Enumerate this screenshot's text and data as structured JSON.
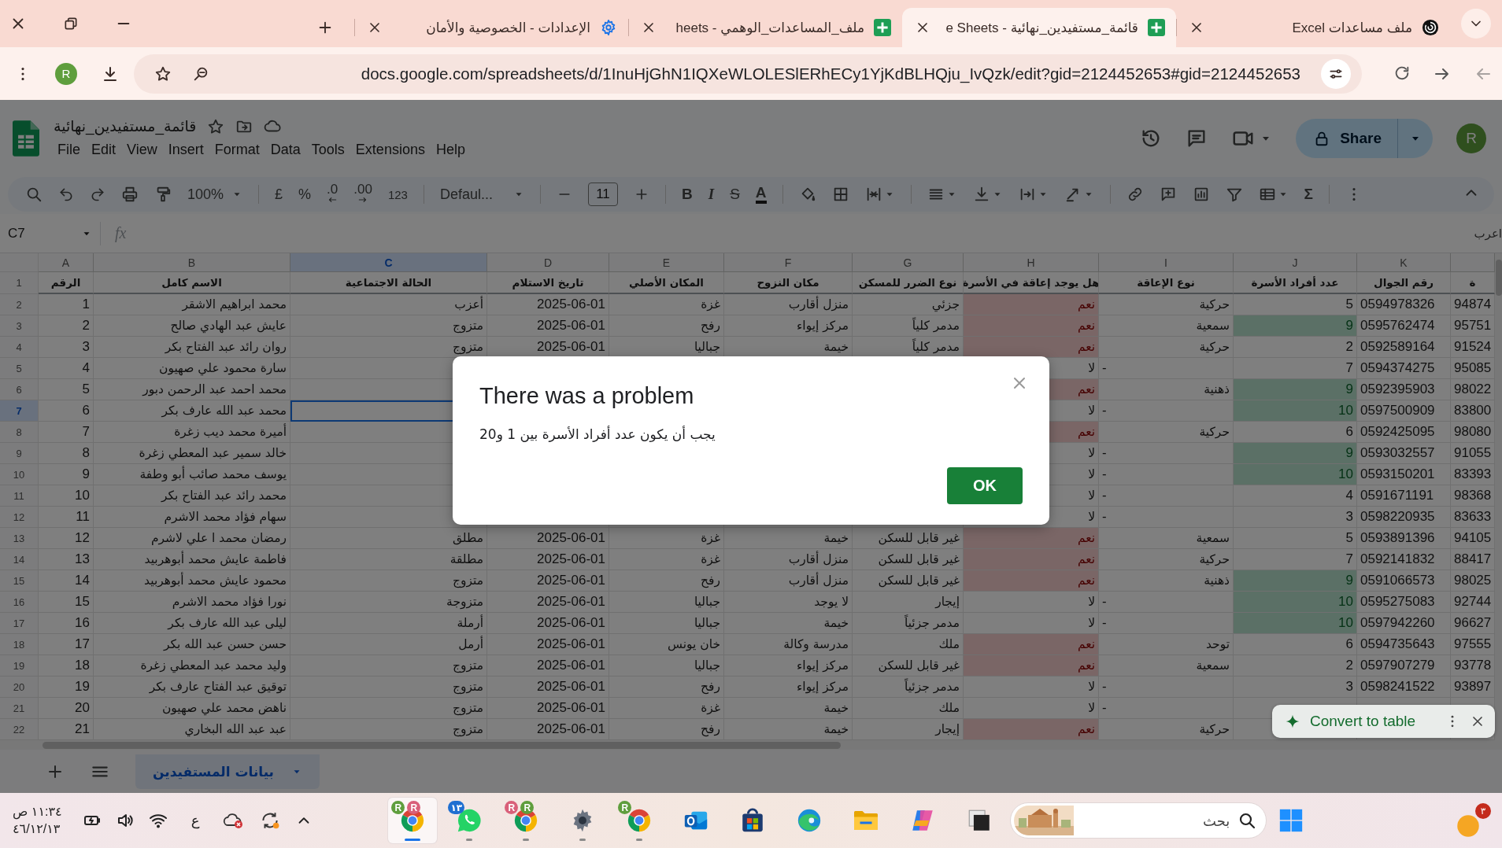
{
  "browser_tabs": [
    {
      "title": "ملف مساعدات Excel",
      "kind": "swirl",
      "selected": false
    },
    {
      "title": "قائمة_مستفيدين_نهائية - e Sheets",
      "kind": "sheets",
      "selected": true
    },
    {
      "title": "ملف_المساعدات_الوهمي - heets",
      "kind": "sheets",
      "selected": false
    },
    {
      "title": "الإعدادات - الخصوصية والأمان",
      "kind": "settings",
      "selected": false
    }
  ],
  "address_bar": {
    "profile_initial": "R",
    "url": "docs.google.com/spreadsheets/d/1InuHjGhN1IQXeWLOLESlERhECy1YjKdBLHQju_IvQzk/edit?gid=2124452653#gid=2124452653"
  },
  "document": {
    "title": "قائمة_مستفيدين_نهائية",
    "menu": [
      "Help",
      "Extensions",
      "Tools",
      "Data",
      "Format",
      "Insert",
      "View",
      "Edit",
      "File"
    ],
    "share_label": "Share",
    "avatar_initial": "R"
  },
  "toolbar": {
    "zoom": "100%",
    "currency": "£",
    "percent": "%",
    "decrease_decimal": ".0",
    "increase_decimal": ".00",
    "number_format": "123",
    "font": "Defaul...",
    "font_size": "11",
    "bold": "B",
    "italic": "I",
    "strikethrough": "S",
    "text_color": "A",
    "functions": "Σ"
  },
  "formula_bar": {
    "cell_reference": "C7",
    "fx": "fx",
    "cut_text": "اعرب"
  },
  "sheet": {
    "header_row": "1",
    "columns": [
      {
        "title": "ة",
        "selected": false
      },
      {
        "letter": "K",
        "title": "رقم الجوال",
        "selected": false
      },
      {
        "letter": "J",
        "title": "عدد أفراد الأسرة",
        "selected": false
      },
      {
        "letter": "I",
        "title": "نوع الإعاقة",
        "selected": false
      },
      {
        "letter": "H",
        "title": "هل يوجد إعاقة في الأسرة",
        "selected": false
      },
      {
        "letter": "G",
        "title": "نوع الضرر للمسكن",
        "selected": false
      },
      {
        "letter": "F",
        "title": "مكان النزوح",
        "selected": false
      },
      {
        "letter": "E",
        "title": "المكان الأصلي",
        "selected": false
      },
      {
        "letter": "D",
        "title": "تاريخ الاستلام",
        "selected": false
      },
      {
        "letter": "C",
        "title": "الحالة الاجتماعية",
        "selected": true
      },
      {
        "letter": "B",
        "title": "الاسم كامل",
        "selected": false
      },
      {
        "letter": "A",
        "title": "الرقم",
        "selected": false
      }
    ],
    "rows": [
      {
        "row": "2",
        "selected": false,
        "number": "1",
        "full_name": "محمد ابراهيم الاشقر",
        "marital_status": "أعزب",
        "received_date": "2025-06-01",
        "origin": "غزة",
        "displacement_place": "منزل أقارب",
        "housing_damage": "جزئي",
        "has_disability": "نعم",
        "disability_flagged": true,
        "disability_type": "حركية",
        "family_size": "5",
        "family_size_flagged": false,
        "mobile": "0594978326",
        "column_12": "94874"
      },
      {
        "row": "3",
        "selected": false,
        "number": "2",
        "full_name": "عايش عبد الهادي صالح",
        "marital_status": "متزوج",
        "received_date": "2025-06-01",
        "origin": "رفح",
        "displacement_place": "مركز إيواء",
        "housing_damage": "مدمر كلياً",
        "has_disability": "نعم",
        "disability_flagged": true,
        "disability_type": "سمعية",
        "family_size": "9",
        "family_size_flagged": true,
        "mobile": "0595762474",
        "column_12": "95751"
      },
      {
        "row": "4",
        "selected": false,
        "number": "3",
        "full_name": "روان رائد  عبد الفتاح بكر",
        "marital_status": "متزوج",
        "received_date": "2025-06-01",
        "origin": "جباليا",
        "displacement_place": "خيمة",
        "housing_damage": "مدمر كلياً",
        "has_disability": "نعم",
        "disability_flagged": true,
        "disability_type": "حركية",
        "family_size": "2",
        "family_size_flagged": false,
        "mobile": "0592589164",
        "column_12": "91524"
      },
      {
        "row": "5",
        "selected": false,
        "number": "4",
        "full_name": "سارة محمود علي صهيون",
        "has_disability": "لا",
        "disability_flagged": false,
        "disability_type": "-",
        "family_size": "7",
        "family_size_flagged": false,
        "mobile": "0594374275",
        "column_12": "95085"
      },
      {
        "row": "6",
        "selected": false,
        "number": "5",
        "full_name": "محمد احمد عبد الرحمن دبور",
        "has_disability": "نعم",
        "disability_flagged": true,
        "disability_type": "ذهنية",
        "family_size": "9",
        "family_size_flagged": true,
        "mobile": "0592395903",
        "column_12": "98022"
      },
      {
        "row": "7",
        "selected": true,
        "number": "6",
        "full_name": "محمد عبد الله عارف بكر",
        "has_disability": "لا",
        "disability_flagged": false,
        "disability_type": "-",
        "family_size": "10",
        "family_size_flagged": true,
        "mobile": "0597500909",
        "column_12": "83800"
      },
      {
        "row": "8",
        "selected": false,
        "number": "7",
        "full_name": "أميرة محمد ديب زغرة",
        "has_disability": "نعم",
        "disability_flagged": true,
        "disability_type": "حركية",
        "family_size": "6",
        "family_size_flagged": false,
        "mobile": "0592425095",
        "column_12": "98080"
      },
      {
        "row": "9",
        "selected": false,
        "number": "8",
        "full_name": "خالد سمير عبد المعطي زغرة",
        "has_disability": "لا",
        "disability_flagged": false,
        "disability_type": "-",
        "family_size": "9",
        "family_size_flagged": true,
        "mobile": "0593032557",
        "column_12": "91055"
      },
      {
        "row": "10",
        "selected": false,
        "number": "9",
        "full_name": "يوسف محمد صائب أبو وطفة",
        "has_disability": "لا",
        "disability_flagged": false,
        "disability_type": "-",
        "family_size": "10",
        "family_size_flagged": true,
        "mobile": "0593150201",
        "column_12": "83393"
      },
      {
        "row": "11",
        "selected": false,
        "number": "10",
        "full_name": "محمد رائد عبد الفتاح بكر",
        "has_disability": "لا",
        "disability_flagged": false,
        "disability_type": "-",
        "family_size": "4",
        "family_size_flagged": false,
        "mobile": "0591671191",
        "column_12": "98368"
      },
      {
        "row": "12",
        "selected": false,
        "number": "11",
        "full_name": "سهام فؤاد محمد الاشرم",
        "has_disability": "لا",
        "disability_flagged": false,
        "disability_type": "-",
        "family_size": "3",
        "family_size_flagged": false,
        "mobile": "0598220935",
        "column_12": "83633"
      },
      {
        "row": "13",
        "selected": false,
        "number": "12",
        "full_name": "رمضان محمد ا علي لاشرم",
        "marital_status": "مطلق",
        "received_date": "2025-06-01",
        "origin": "غزة",
        "displacement_place": "خيمة",
        "housing_damage": "غير قابل للسكن",
        "has_disability": "نعم",
        "disability_flagged": true,
        "disability_type": "سمعية",
        "family_size": "5",
        "family_size_flagged": false,
        "mobile": "0593891396",
        "column_12": "94105"
      },
      {
        "row": "14",
        "selected": false,
        "number": "13",
        "full_name": "فاطمة عايش محمد أبوهربيد",
        "marital_status": "مطلقة",
        "received_date": "2025-06-01",
        "origin": "غزة",
        "displacement_place": "منزل أقارب",
        "housing_damage": "غير قابل للسكن",
        "has_disability": "نعم",
        "disability_flagged": true,
        "disability_type": "حركية",
        "family_size": "7",
        "family_size_flagged": false,
        "mobile": "0592141832",
        "column_12": "88417"
      },
      {
        "row": "15",
        "selected": false,
        "number": "14",
        "full_name": "محمود عايش محمد أبوهربيد",
        "marital_status": "متزوج",
        "received_date": "2025-06-01",
        "origin": "رفح",
        "displacement_place": "منزل أقارب",
        "housing_damage": "غير قابل للسكن",
        "has_disability": "نعم",
        "disability_flagged": true,
        "disability_type": "ذهنية",
        "family_size": "9",
        "family_size_flagged": true,
        "mobile": "0591066573",
        "column_12": "98025"
      },
      {
        "row": "16",
        "selected": false,
        "number": "15",
        "full_name": "نورا  فؤاد محمد الاشرم",
        "marital_status": "متزوجة",
        "received_date": "2025-06-01",
        "origin": "جباليا",
        "displacement_place": "لا يوجد",
        "housing_damage": "إيجار",
        "has_disability": "لا",
        "disability_flagged": false,
        "disability_type": "-",
        "family_size": "10",
        "family_size_flagged": true,
        "mobile": "0595275083",
        "column_12": "92744"
      },
      {
        "row": "17",
        "selected": false,
        "number": "16",
        "full_name": "ليلى عبد الله عارف بكر",
        "marital_status": "أرملة",
        "received_date": "2025-06-01",
        "origin": "جباليا",
        "displacement_place": "خيمة",
        "housing_damage": "مدمر جزئياً",
        "has_disability": "لا",
        "disability_flagged": false,
        "disability_type": "-",
        "family_size": "10",
        "family_size_flagged": true,
        "mobile": "0597942260",
        "column_12": "96627"
      },
      {
        "row": "18",
        "selected": false,
        "number": "17",
        "full_name": "حسن حسن عبد الله بكر",
        "marital_status": "أرمل",
        "received_date": "2025-06-01",
        "origin": "خان يونس",
        "displacement_place": "مدرسة وكالة",
        "housing_damage": "ملك",
        "has_disability": "نعم",
        "disability_flagged": true,
        "disability_type": "توحد",
        "family_size": "6",
        "family_size_flagged": false,
        "mobile": "0594735643",
        "column_12": "97555"
      },
      {
        "row": "19",
        "selected": false,
        "number": "18",
        "full_name": "وليد محمد عبد المعطي زغرة",
        "marital_status": "متزوج",
        "received_date": "2025-06-01",
        "origin": "جباليا",
        "displacement_place": "مركز إيواء",
        "housing_damage": "غير قابل للسكن",
        "has_disability": "نعم",
        "disability_flagged": true,
        "disability_type": "سمعية",
        "family_size": "2",
        "family_size_flagged": false,
        "mobile": "0597907279",
        "column_12": "93778"
      },
      {
        "row": "20",
        "selected": false,
        "number": "19",
        "full_name": "توقيق عبد الفتاح عارف بكر",
        "marital_status": "متزوج",
        "received_date": "2025-06-01",
        "origin": "رفح",
        "displacement_place": "مركز إيواء",
        "housing_damage": "مدمر جزئياً",
        "has_disability": "لا",
        "disability_flagged": false,
        "disability_type": "-",
        "family_size": "3",
        "family_size_flagged": false,
        "mobile": "0598241522",
        "column_12": "93897"
      },
      {
        "row": "21",
        "selected": false,
        "number": "20",
        "full_name": "ناهض محمد علي صهيون",
        "marital_status": "متزوج",
        "received_date": "2025-06-01",
        "origin": "غزة",
        "displacement_place": "خيمة",
        "housing_damage": "ملك",
        "has_disability": "لا",
        "disability_flagged": false,
        "disability_type": "-"
      },
      {
        "row": "22",
        "selected": false,
        "number": "21",
        "full_name": "عبد عبد الله البخاري",
        "marital_status": "متزوج",
        "received_date": "2025-06-01",
        "origin": "رفح",
        "displacement_place": "خيمة",
        "housing_damage": "إيجار",
        "has_disability": "نعم",
        "disability_flagged": true,
        "disability_type": "حركية"
      }
    ]
  },
  "sheet_tabs": [
    {
      "name": "بيانات المستفيدين",
      "selected": true
    }
  ],
  "dialog": {
    "title": "There was a problem",
    "message": "يجب أن يكون عدد أفراد الأسرة بين 1 و20",
    "button": "OK"
  },
  "convert_chip": {
    "label": "Convert to table"
  },
  "taskbar": {
    "time": "١١:٣٤ ص",
    "date": "٤٦/١٢/١٣",
    "language": "ع",
    "search_placeholder": "بحث",
    "notification_count": "٣",
    "apps": [
      {
        "kind": "app",
        "selected": false,
        "running": false
      },
      {
        "kind": "copilot",
        "selected": false,
        "running": false
      },
      {
        "kind": "explorer",
        "selected": false,
        "running": false
      },
      {
        "kind": "edge",
        "selected": false,
        "running": false
      },
      {
        "kind": "store",
        "selected": false,
        "running": false
      },
      {
        "kind": "outlook",
        "selected": false,
        "running": false
      },
      {
        "kind": "chrome",
        "selected": false,
        "running": true,
        "badges": [
          {
            "text": "R",
            "color": "#5f9e3d"
          }
        ]
      },
      {
        "kind": "settings",
        "selected": false,
        "running": true
      },
      {
        "kind": "chrome",
        "selected": false,
        "running": true,
        "badges": [
          {
            "text": "R",
            "color": "#5f9e3d"
          },
          {
            "text": "R",
            "color": "#d9607a"
          }
        ]
      },
      {
        "kind": "whatsapp",
        "selected": false,
        "running": true,
        "badges": [
          {
            "text": "١٣",
            "color": "#1f6fd1"
          }
        ]
      },
      {
        "kind": "chrome",
        "selected": true,
        "running": true,
        "badges": [
          {
            "text": "R",
            "color": "#d9607a"
          },
          {
            "text": "R",
            "color": "#5f9e3d"
          }
        ]
      }
    ]
  }
}
